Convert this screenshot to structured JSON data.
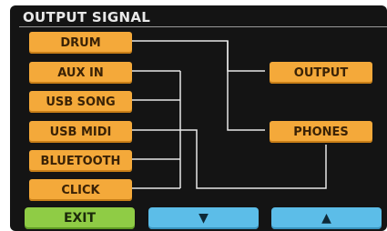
{
  "title": "OUTPUT SIGNAL",
  "sources": [
    {
      "label": "DRUM"
    },
    {
      "label": "AUX IN"
    },
    {
      "label": "USB SONG"
    },
    {
      "label": "USB MIDI"
    },
    {
      "label": "BLUETOOTH"
    },
    {
      "label": "CLICK"
    }
  ],
  "destinations": [
    {
      "label": "OUTPUT"
    },
    {
      "label": "PHONES"
    }
  ],
  "footer": {
    "exit_label": "EXIT",
    "down_label": "▼",
    "up_label": "▲"
  },
  "colors": {
    "background": "#141414",
    "source_button": "#f4a93a",
    "exit_button": "#8fcc45",
    "nav_button": "#5cbde8",
    "wire": "#e6e6e6"
  }
}
